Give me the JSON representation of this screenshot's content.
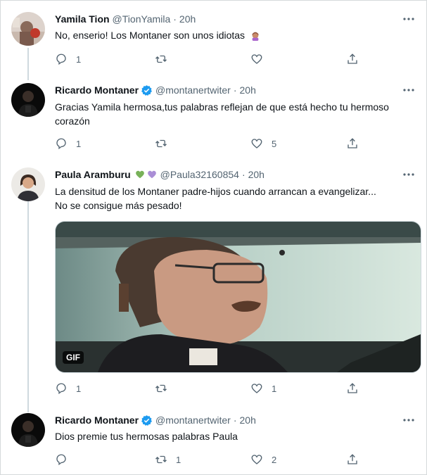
{
  "tweets": [
    {
      "name": "Yamila Tion",
      "handle": "@TionYamila",
      "sep": "·",
      "time": "20h",
      "text": "No, enserio! Los Montaner son unos idiotas",
      "reply_count": "1",
      "retweet_count": "",
      "like_count": "",
      "verified": false
    },
    {
      "name": "Ricardo Montaner",
      "handle": "@montanertwiter",
      "sep": "·",
      "time": "20h",
      "text": "Gracias Yamila hermosa,tus palabras reflejan de que está hecho tu hermoso corazón",
      "reply_count": "1",
      "retweet_count": "",
      "like_count": "5",
      "verified": true
    },
    {
      "name": "Paula Aramburu",
      "handle": "@Paula32160854",
      "sep": "·",
      "time": "20h",
      "text_line1": "La densitud de los Montaner padre-hijos cuando arrancan a evangelizar...",
      "text_line2": "No se consigue más pesado!",
      "media_badge": "GIF",
      "reply_count": "1",
      "retweet_count": "",
      "like_count": "1",
      "verified": false
    },
    {
      "name": "Ricardo Montaner",
      "handle": "@montanertwiter",
      "sep": "·",
      "time": "20h",
      "text": "Dios premie tus hermosas palabras Paula",
      "reply_count": "",
      "retweet_count": "1",
      "like_count": "2",
      "verified": true
    }
  ],
  "colors": {
    "verified": "#1d9bf0",
    "text_secondary": "#536471",
    "thread_line": "#cfd9de",
    "heart_green": "#78b159",
    "heart_purple": "#aa8ed6"
  },
  "icons": {
    "reply": "reply-icon",
    "retweet": "retweet-icon",
    "like": "heart-icon",
    "share": "share-icon",
    "more": "more-icon",
    "verified": "verified-badge-icon"
  }
}
